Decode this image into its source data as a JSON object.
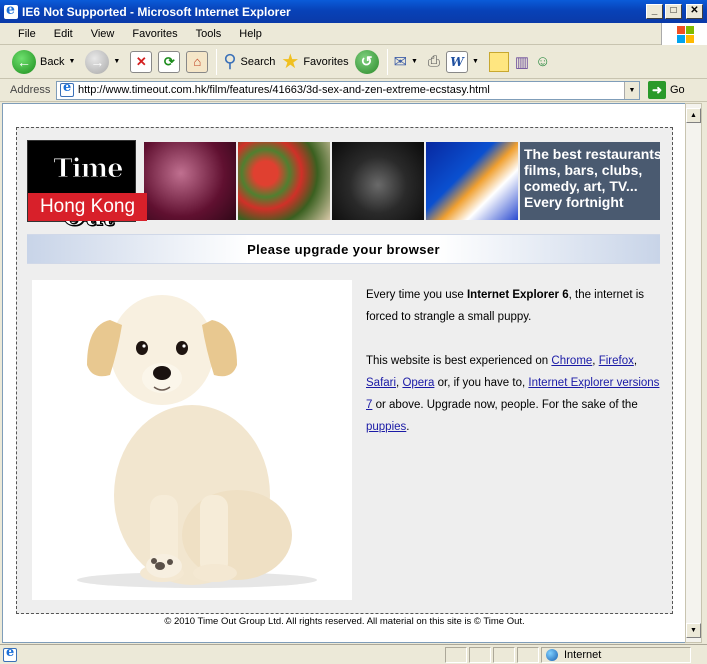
{
  "window": {
    "title": "IE6 Not Supported - Microsoft Internet Explorer",
    "minimize_label": "_",
    "maximize_label": "□",
    "close_label": "✕"
  },
  "menu": {
    "items": [
      "File",
      "Edit",
      "View",
      "Favorites",
      "Tools",
      "Help"
    ]
  },
  "toolbar": {
    "back_label": "Back",
    "search_label": "Search",
    "favorites_label": "Favorites"
  },
  "address": {
    "label": "Address",
    "url": "http://www.timeout.com.hk/film/features/41663/3d-sex-and-zen-extreme-ecstasy.html",
    "go_label": "Go"
  },
  "page": {
    "logo_line1": "Time Out",
    "logo_line2": "Hong Kong",
    "tagline_lines": [
      "The best restaurants,",
      "films, bars, clubs,",
      "comedy, art, TV...",
      "Every fortnight"
    ],
    "heading": "Please upgrade your browser",
    "para1_prefix": "Every time you use ",
    "para1_bold": "Internet Explorer 6",
    "para1_suffix": ", the internet is forced to strangle a small puppy.",
    "para2_prefix": "This website is best experienced on ",
    "link_chrome": "Chrome",
    "comma1": ", ",
    "link_firefox": "Firefox",
    "comma2": ", ",
    "link_safari": "Safari",
    "comma3": ", ",
    "link_opera": "Opera",
    "para2_middle": " or, if you have to, ",
    "link_ie7": "Internet Explorer versions 7",
    "para2_after_ie": " or above. Upgrade now, people. For the sake of the ",
    "link_puppies": "puppies",
    "para2_end": ".",
    "footer": "© 2010 Time Out Group Ltd. All rights reserved. All material on this site is © Time Out."
  },
  "status": {
    "zone": "Internet"
  },
  "colors": {
    "title_bar": "#0842b8",
    "logo_red": "#d8202a",
    "link": "#1a1aa6",
    "tagline_bg": "#4a5a70"
  }
}
